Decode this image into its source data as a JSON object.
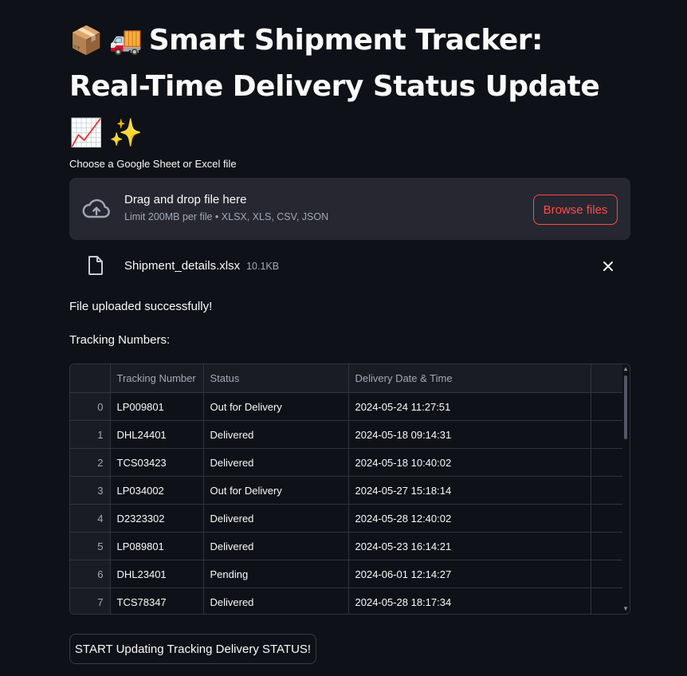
{
  "title": {
    "emoji_1": "📦",
    "emoji_2": "🚚",
    "text": "Smart Shipment Tracker: Real-Time Delivery Status Update",
    "emoji_3": "📈",
    "emoji_4": "✨"
  },
  "uploader": {
    "label": "Choose a Google Sheet or Excel file",
    "drop_title": "Drag and drop file here",
    "drop_subtitle": "Limit 200MB per file • XLSX, XLS, CSV, JSON",
    "browse_label": "Browse files",
    "file_name": "Shipment_details.xlsx",
    "file_size": "10.1KB"
  },
  "messages": {
    "success": "File uploaded successfully!",
    "tracking_heading": "Tracking Numbers:"
  },
  "table": {
    "columns": [
      "",
      "Tracking Number",
      "Status",
      "Delivery Date & Time"
    ],
    "rows": [
      [
        "0",
        "LP009801",
        "Out for Delivery",
        "2024-05-24 11:27:51"
      ],
      [
        "1",
        "DHL24401",
        "Delivered",
        "2024-05-18 09:14:31"
      ],
      [
        "2",
        "TCS03423",
        "Delivered",
        "2024-05-18 10:40:02"
      ],
      [
        "3",
        "LP034002",
        "Out for Delivery",
        "2024-05-27 15:18:14"
      ],
      [
        "4",
        "D2323302",
        "Delivered",
        "2024-05-28 12:40:02"
      ],
      [
        "5",
        "LP089801",
        "Delivered",
        "2024-05-23 16:14:21"
      ],
      [
        "6",
        "DHL23401",
        "Pending",
        "2024-06-01 12:14:27"
      ],
      [
        "7",
        "TCS78347",
        "Delivered",
        "2024-05-28 18:17:34"
      ]
    ]
  },
  "actions": {
    "start_label": "START Updating Tracking Delivery STATUS!"
  },
  "colors": {
    "background": "#0e1117",
    "accent": "#ff4b4b",
    "surface": "#262730"
  }
}
